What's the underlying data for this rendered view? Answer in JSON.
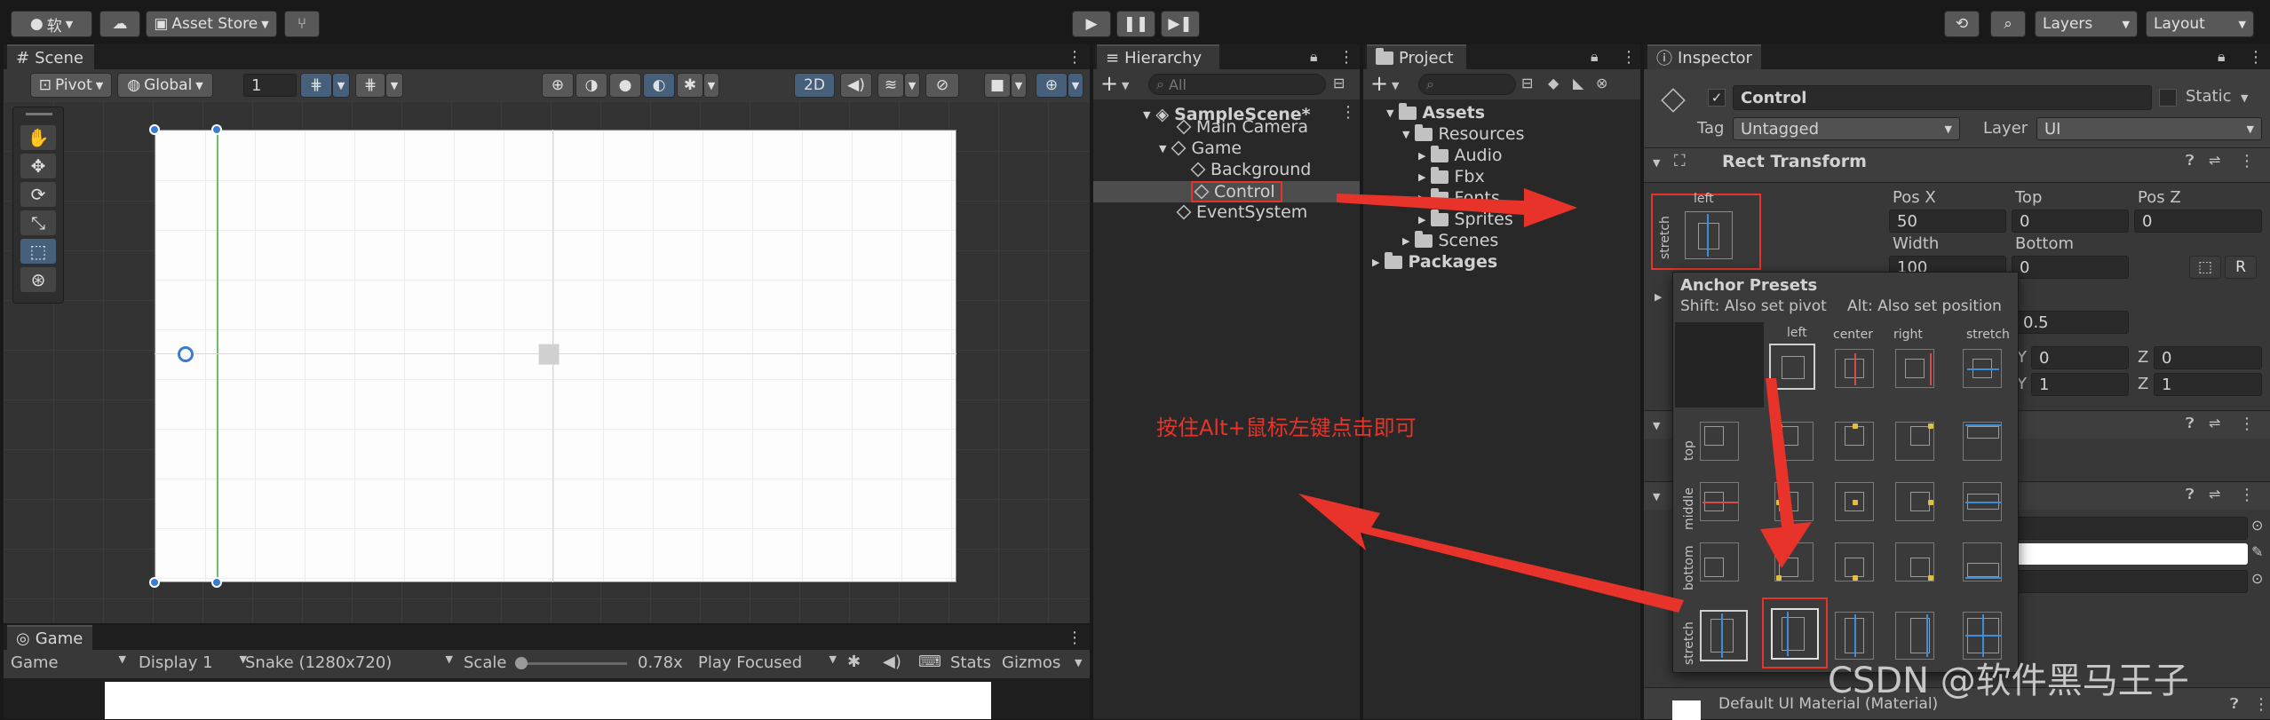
{
  "top_toolbar": {
    "account_label": "软",
    "asset_store": "Asset Store",
    "layers": "Layers",
    "layout": "Layout"
  },
  "scene": {
    "tab": "Scene",
    "pivot": "Pivot",
    "global": "Global",
    "grid_value": "1",
    "mode_2d": "2D"
  },
  "game": {
    "tab": "Game",
    "mode": "Game",
    "display": "Display 1",
    "resolution": "Snake (1280x720)",
    "scale_label": "Scale",
    "scale_value": "0.78x",
    "play_focused": "Play Focused",
    "stats": "Stats",
    "gizmos": "Gizmos"
  },
  "hierarchy": {
    "tab": "Hierarchy",
    "search_placeholder": "All",
    "items": [
      "SampleScene*",
      "Main Camera",
      "Game",
      "Background",
      "Control",
      "EventSystem"
    ]
  },
  "project": {
    "tab": "Project",
    "items": [
      "Assets",
      "Resources",
      "Audio",
      "Fbx",
      "Fonts",
      "Sprites",
      "Scenes",
      "Packages"
    ]
  },
  "inspector": {
    "tab": "Inspector",
    "object_name": "Control",
    "static_label": "Static",
    "tag_label": "Tag",
    "tag_value": "Untagged",
    "layer_label": "Layer",
    "layer_value": "UI",
    "rect_transform": "Rect Transform",
    "anchor_h_label": "left",
    "anchor_v_label": "stretch",
    "pos_x_label": "Pos X",
    "top_label": "Top",
    "pos_z_label": "Pos Z",
    "pos_x": "50",
    "top": "0",
    "pos_z": "0",
    "width_label": "Width",
    "bottom_label": "Bottom",
    "width": "100",
    "bottom": "0",
    "pivot_y": "0.5",
    "y_label": "Y",
    "z_label": "Z",
    "rot_y": "0",
    "rot_z": "0",
    "scale_y": "1",
    "scale_z": "1",
    "material": "Default UI Material (Material)"
  },
  "anchor_presets": {
    "title": "Anchor Presets",
    "shift_hint": "Shift: Also set pivot",
    "alt_hint": "Alt: Also set position",
    "col_labels": [
      "left",
      "center",
      "right",
      "stretch"
    ],
    "row_labels": [
      "top",
      "middle",
      "bottom",
      "stretch"
    ]
  },
  "annotation": {
    "text": "按住Alt+鼠标左键点击即可",
    "color": "#e8332a"
  },
  "watermark": "CSDN @软件黑马王子",
  "colors": {
    "accent": "#2c5d87",
    "selection": "#4d4d4d",
    "highlight_red": "#e8332a"
  }
}
